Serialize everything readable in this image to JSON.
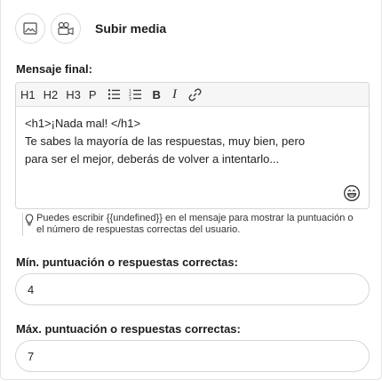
{
  "media": {
    "label": "Subir media",
    "image_icon": "image-icon",
    "video_icon": "video-camera-icon"
  },
  "final_message": {
    "label": "Mensaje final:",
    "toolbar": {
      "h1": "H1",
      "h2": "H2",
      "h3": "H3",
      "p": "P",
      "bullet_list_icon": "bullet-list-icon",
      "numbered_list_icon": "numbered-list-icon",
      "bold": "B",
      "italic": "I",
      "link_icon": "link-icon"
    },
    "content_lines": [
      "<h1>¡Nada mal! </h1>",
      "Te sabes la mayoría de las respuestas, muy bien, pero",
      "para ser el mejor, deberás de volver a intentarlo..."
    ],
    "emoji_icon": "emoji-icon"
  },
  "hint": {
    "icon": "lightbulb-icon",
    "text": "Puedes escribir {{undefined}} en el mensaje para mostrar la puntuación o el número de respuestas correctas del usuario."
  },
  "min_score": {
    "label": "Mín. puntuación o respuestas correctas:",
    "value": "4"
  },
  "max_score": {
    "label": "Máx. puntuación o respuestas correctas:",
    "value": "7"
  }
}
